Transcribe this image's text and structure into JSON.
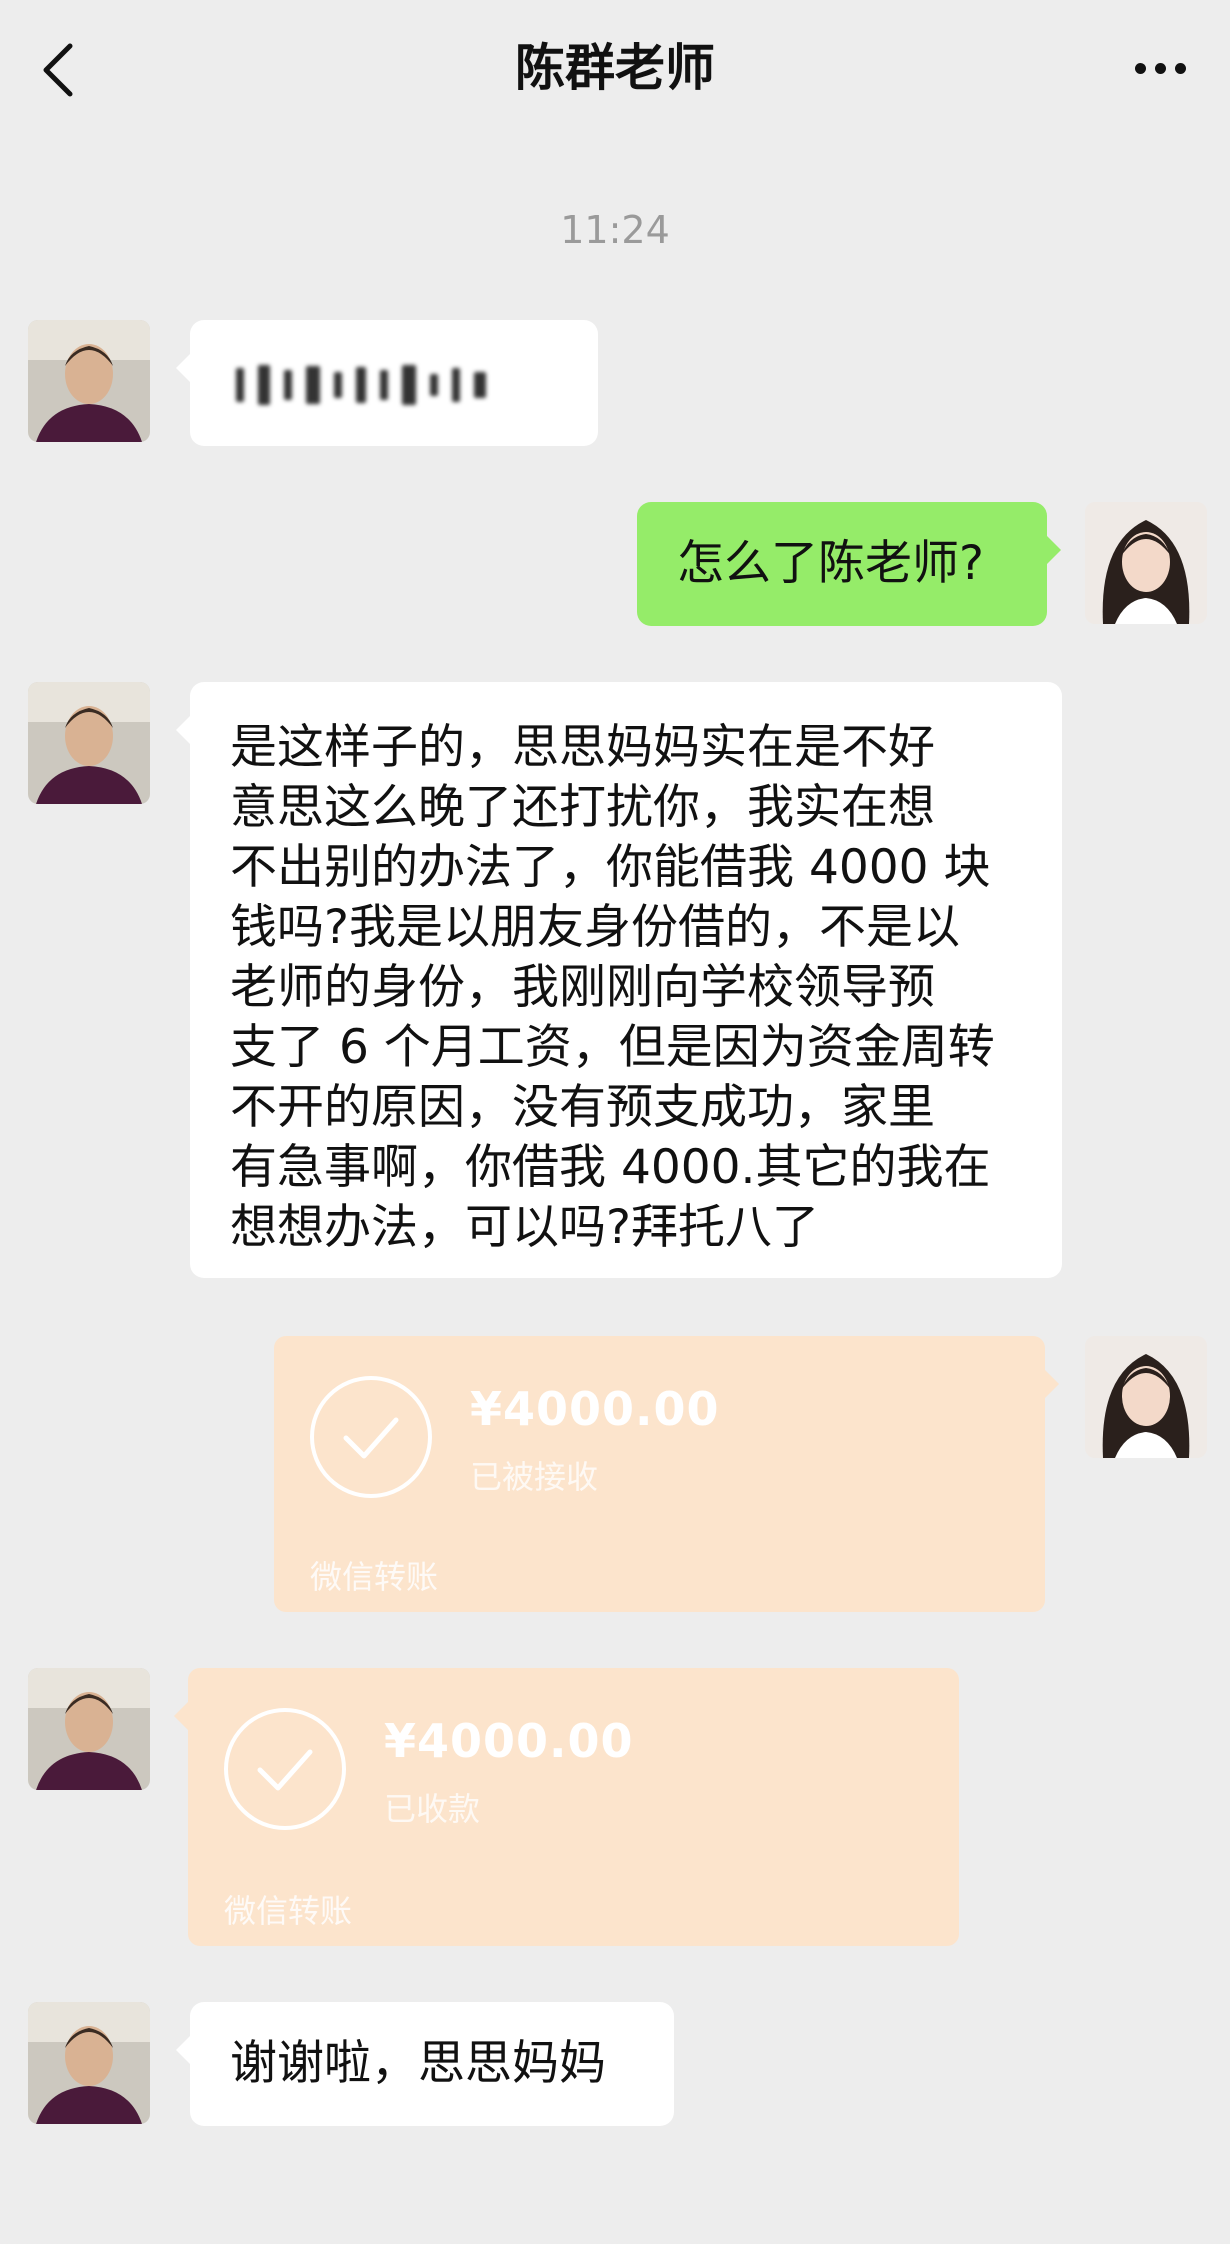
{
  "header": {
    "title": "陈群老师"
  },
  "timestamp": "11:24",
  "messages": {
    "m2": "怎么了陈老师?",
    "m3": [
      "是这样子的，思思妈妈实在是不好",
      "意思这么晚了还打扰你，我实在想",
      "不出别的办法了，你能借我 4000 块",
      "钱吗?我是以朋友身份借的，不是以",
      "老师的身份，我刚刚向学校领导预",
      "支了 6 个月工资，但是因为资金周转",
      "不开的原因，没有预支成功，家里",
      "有急事啊，你借我 4000.其它的我在",
      "想想办法，可以吗?拜托八了"
    ],
    "m6": "谢谢啦，思思妈妈"
  },
  "transfers": [
    {
      "amount": "¥4000.00",
      "status": "已被接收",
      "footer": "微信转账"
    },
    {
      "amount": "¥4000.00",
      "status": "已收款",
      "footer": "微信转账"
    }
  ],
  "icons": {
    "back": "chevron-left-icon",
    "more": "more-dots-icon",
    "check": "check-circle-icon"
  },
  "colors": {
    "background": "#ededed",
    "bubble_sent": "#95ec69",
    "bubble_received": "#ffffff",
    "transfer": "#fce4cc"
  }
}
